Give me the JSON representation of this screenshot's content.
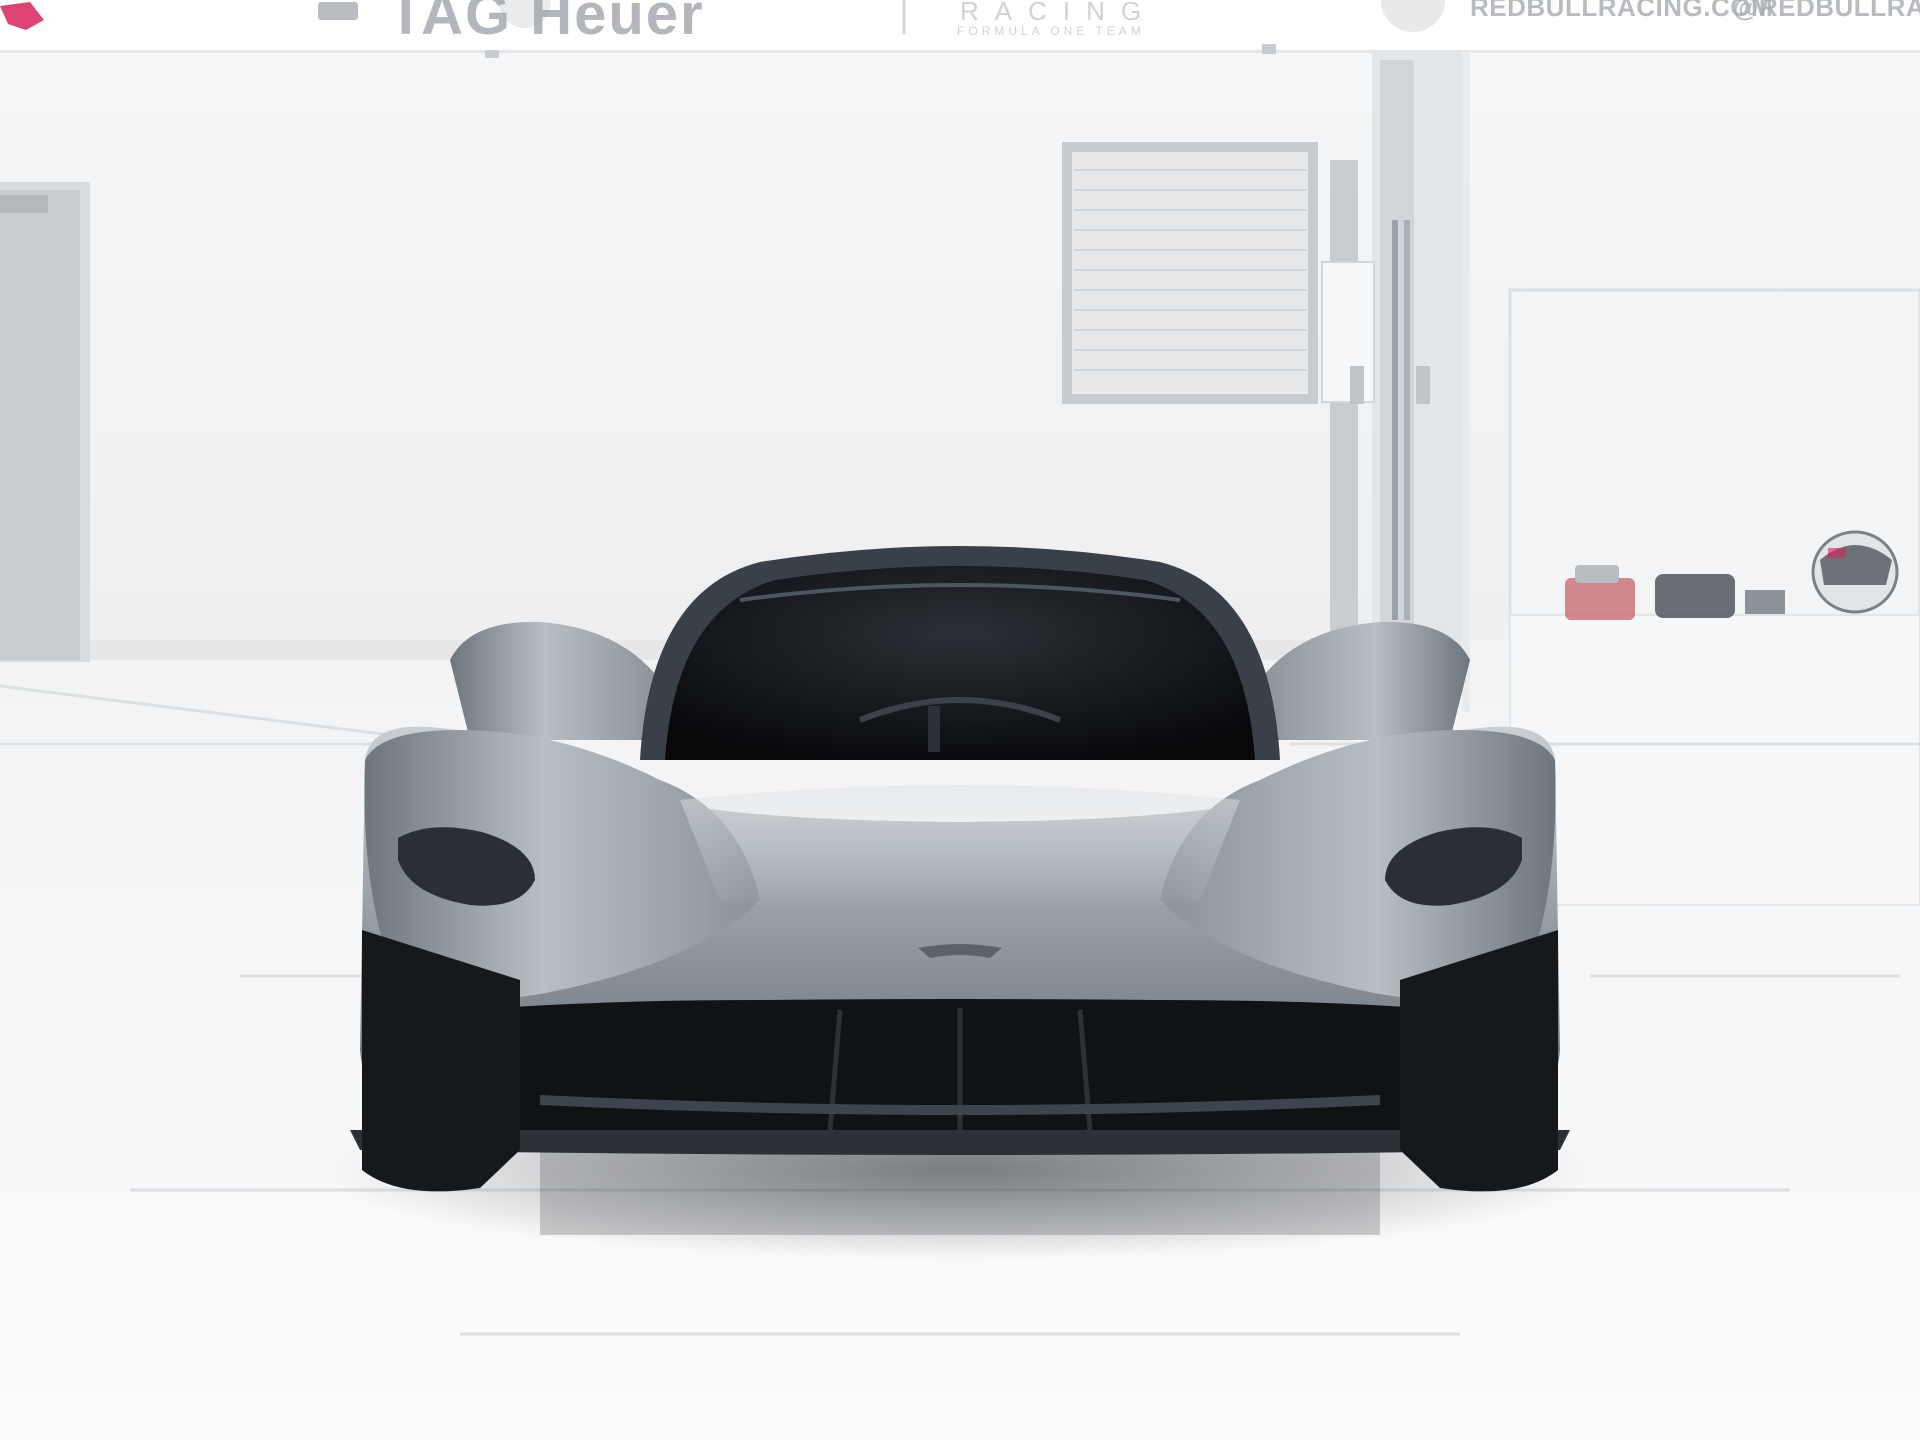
{
  "banner": {
    "sponsor_text": "TAG Heuer",
    "team_text": "RACING",
    "team_subtext": "FORMULA ONE TEAM",
    "website_text": "REDBULLRACING.COM",
    "handle_text": "@REDBULLRACING"
  },
  "colors": {
    "wall": "#f2f3f4",
    "floor": "#f7f8f9",
    "car_body": "#9aa2a8",
    "glass": "#121519",
    "accent_logo": "#d8225b"
  }
}
